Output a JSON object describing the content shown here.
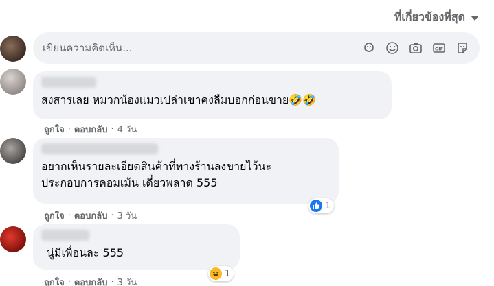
{
  "sort": {
    "label": "ที่เกี่ยวข้องที่สุด"
  },
  "composer": {
    "placeholder": "เขียนความคิดเห็น..."
  },
  "comments": [
    {
      "text": "สงสารเลย หมวกน้องแมวเปล่าเขาคงลืมบอกก่อนขาย🤣🤣",
      "like": "ถูกใจ",
      "reply": "ตอบกลับ",
      "time": "4 วัน"
    },
    {
      "text": "อยากเห็นรายละเอียดสินค้าที่ทางร้านลงขายไว้นะ\nประกอบการคอมเม้น เดี๋ยวพลาด 555",
      "like": "ถูกใจ",
      "reply": "ตอบกลับ",
      "time": "3 วัน",
      "reaction": {
        "icon": "like-reaction-icon",
        "count": "1"
      }
    },
    {
      "text": "นู่มีเพื่อนละ 555",
      "like": "ถูกใจ",
      "reply": "ตอบกลับ",
      "time": "3 วัน",
      "reaction": {
        "icon": "haha-reaction-icon",
        "count": "1"
      }
    }
  ],
  "icons": {
    "composer": [
      "avatar-sticker-icon",
      "emoji-icon",
      "camera-icon",
      "gif-icon",
      "sticker-icon"
    ],
    "sort_caret": "caret-down-icon"
  },
  "colors": {
    "bubble": "#f0f2f5",
    "secondary_text": "#65676b",
    "like_blue": "#1877f2",
    "haha_yellow": "#f7b928"
  }
}
